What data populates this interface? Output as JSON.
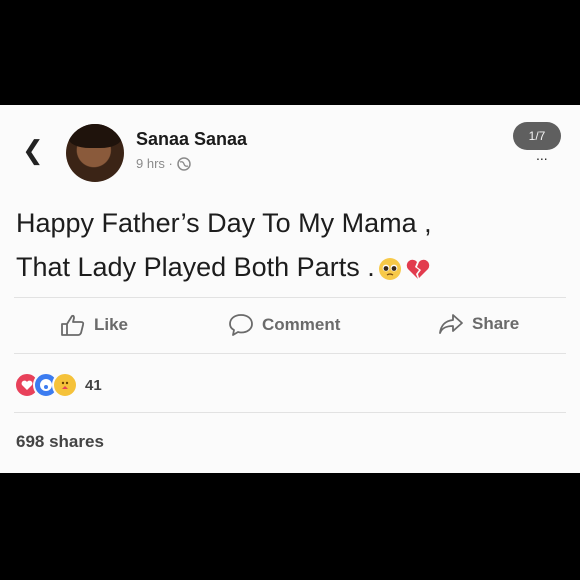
{
  "post": {
    "author": "Sanaa Sanaa",
    "time": "9 hrs ·",
    "photo_counter": "1/7",
    "more_label": "...",
    "text_line1": "Happy Father’s Day To My Mama ,",
    "text_line2": "That Lady Played Both Parts .",
    "emojis": [
      "pleading-face-emoji",
      "broken-heart-emoji"
    ]
  },
  "actions": {
    "like": "Like",
    "comment": "Comment",
    "share": "Share"
  },
  "reactions": {
    "icons": [
      "love-reaction-icon",
      "wow-reaction-icon",
      "care-reaction-icon"
    ],
    "count": "41"
  },
  "shares": "698 shares",
  "colors": {
    "background": "#000000",
    "card": "#fbfbfb",
    "love": "#e8415a",
    "wow": "#3c7cf0",
    "care": "#f5c23a"
  }
}
